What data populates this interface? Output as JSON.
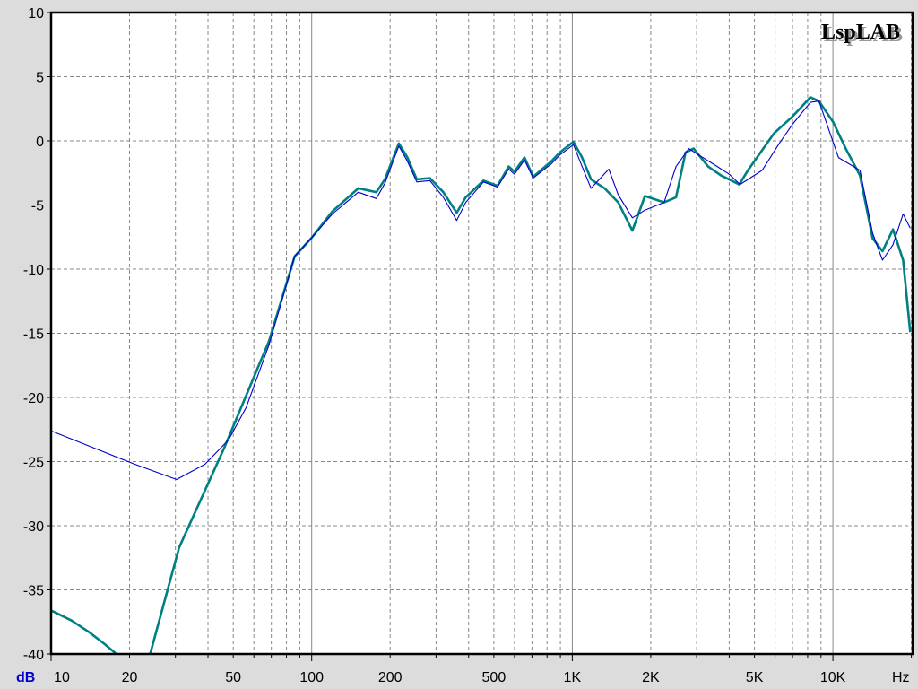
{
  "chart_data": {
    "type": "line",
    "title": "",
    "logo": "LspLAB",
    "xlabel": "Hz",
    "ylabel": "dB",
    "xscale": "log",
    "xlim": [
      10,
      20000
    ],
    "ylim": [
      -40,
      10
    ],
    "grid": true,
    "x_ticks": [
      {
        "v": 10,
        "label": "10"
      },
      {
        "v": 20,
        "label": "20"
      },
      {
        "v": 50,
        "label": "50"
      },
      {
        "v": 100,
        "label": "100"
      },
      {
        "v": 200,
        "label": "200"
      },
      {
        "v": 500,
        "label": "500"
      },
      {
        "v": 1000,
        "label": "1K"
      },
      {
        "v": 2000,
        "label": "2K"
      },
      {
        "v": 5000,
        "label": "5K"
      },
      {
        "v": 10000,
        "label": "10K"
      }
    ],
    "y_ticks": [
      {
        "v": 10,
        "label": "10"
      },
      {
        "v": 5,
        "label": "5"
      },
      {
        "v": 0,
        "label": "0"
      },
      {
        "v": -5,
        "label": "-5"
      },
      {
        "v": -10,
        "label": "-10"
      },
      {
        "v": -15,
        "label": "-15"
      },
      {
        "v": -20,
        "label": "-20"
      },
      {
        "v": -25,
        "label": "-25"
      },
      {
        "v": -30,
        "label": "-30"
      },
      {
        "v": -35,
        "label": "-35"
      },
      {
        "v": -40,
        "label": "-40"
      }
    ],
    "series": [
      {
        "name": "teal",
        "color": "#008080",
        "x": [
          10,
          12,
          14,
          16,
          17.8,
          null,
          24,
          31,
          46,
          68.6,
          86,
          100,
          120,
          151,
          177,
          191,
          216,
          233,
          253,
          284,
          320,
          360,
          390,
          456,
          516,
          570,
          600,
          655,
          708,
          830,
          896,
          1010,
          1090,
          1180,
          1330,
          1500,
          1700,
          1900,
          2250,
          2500,
          2720,
          2920,
          3320,
          3720,
          4370,
          4720,
          5950,
          7000,
          8200,
          8840,
          10000,
          11200,
          12700,
          14200,
          15500,
          17000,
          18600,
          19800
        ],
        "y": [
          -36.6,
          -37.4,
          -38.3,
          -39.2,
          -40,
          null,
          -40,
          -31.7,
          -24,
          -15.6,
          -9,
          -7.55,
          -5.5,
          -3.7,
          -4,
          -3,
          -0.2,
          -1.3,
          -3,
          -2.9,
          -4,
          -5.6,
          -4.4,
          -3.1,
          -3.5,
          -2,
          -2.4,
          -1.3,
          -2.8,
          -1.6,
          -0.9,
          -0.07,
          -1.3,
          -3,
          -3.7,
          -4.8,
          -7,
          -4.3,
          -4.8,
          -4.4,
          -0.9,
          -0.6,
          -2,
          -2.7,
          -3.4,
          -2.3,
          0.6,
          1.9,
          3.4,
          3.1,
          1.5,
          -0.6,
          -2.7,
          -7.6,
          -8.6,
          -6.9,
          -9.3,
          -14.9
        ]
      },
      {
        "name": "blue",
        "color": "#0000cc",
        "x": [
          10,
          14,
          20.9,
          30.3,
          39,
          48,
          56,
          68.6,
          86,
          100,
          120,
          151,
          177,
          191,
          216,
          233,
          253,
          284,
          320,
          360,
          390,
          456,
          516,
          570,
          600,
          655,
          708,
          830,
          896,
          1010,
          1090,
          1180,
          1380,
          1500,
          1700,
          1900,
          2250,
          2500,
          2800,
          3000,
          3600,
          4000,
          4400,
          5350,
          6220,
          7000,
          8200,
          8840,
          10500,
          12700,
          14200,
          15500,
          17000,
          18600,
          19800
        ],
        "y": [
          -22.6,
          -23.8,
          -25.2,
          -26.4,
          -25.2,
          -23.3,
          -20.8,
          -15.9,
          -9,
          -7.55,
          -5.7,
          -4,
          -4.5,
          -3.3,
          -0.4,
          -1.6,
          -3.2,
          -3.1,
          -4.4,
          -6.2,
          -4.8,
          -3.2,
          -3.6,
          -2.2,
          -2.6,
          -1.5,
          -2.9,
          -1.8,
          -1.1,
          -0.3,
          -2,
          -3.7,
          -2.2,
          -4.2,
          -6,
          -5.4,
          -4.8,
          -2,
          -0.6,
          -1,
          -2,
          -2.6,
          -3.4,
          -2.3,
          -0.2,
          1.3,
          3,
          3.1,
          -1.3,
          -2.3,
          -7.2,
          -9.3,
          -8.1,
          -5.7,
          -6.8
        ]
      }
    ]
  }
}
